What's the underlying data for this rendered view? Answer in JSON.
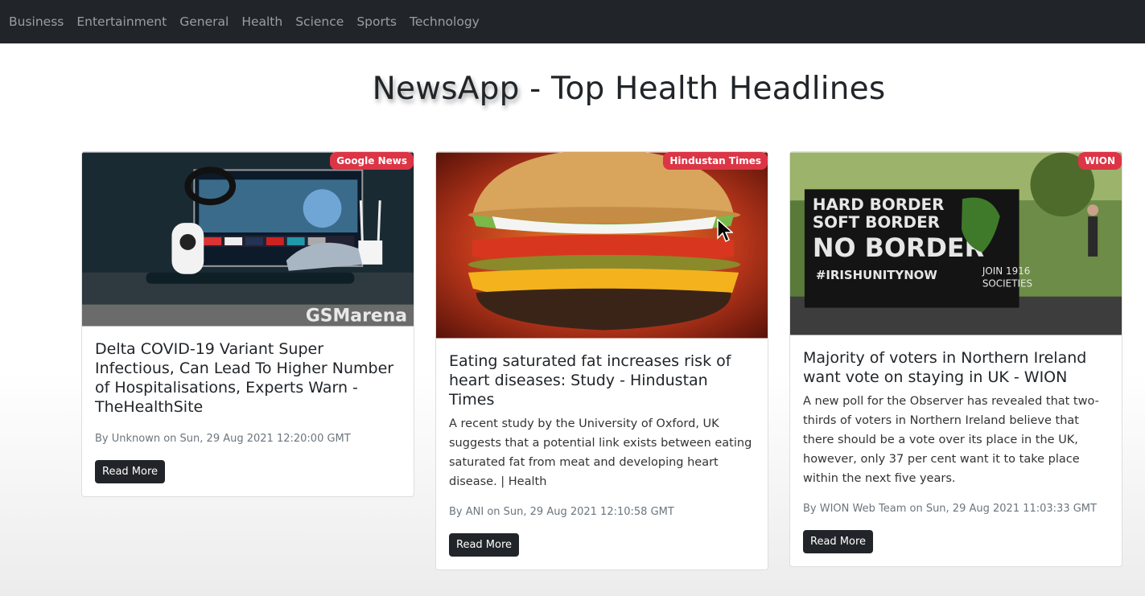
{
  "nav": {
    "items": [
      {
        "label": "Business"
      },
      {
        "label": "Entertainment"
      },
      {
        "label": "General"
      },
      {
        "label": "Health"
      },
      {
        "label": "Science"
      },
      {
        "label": "Sports"
      },
      {
        "label": "Technology"
      }
    ]
  },
  "page": {
    "title_brand": "NewsApp",
    "title_rest": " - Top Health Headlines"
  },
  "cards": [
    {
      "source": "Google News",
      "image_watermark": "GSMarena",
      "title": "Delta COVID-19 Variant Super Infectious, Can Lead To Higher Number of Hospitalisations, Experts Warn - TheHealthSite",
      "description": "",
      "meta": "By Unknown on Sun, 29 Aug 2021 12:20:00 GMT",
      "button": "Read More"
    },
    {
      "source": "Hindustan Times",
      "title": "Eating saturated fat increases risk of heart diseases: Study - Hindustan Times",
      "description": "A recent study by the University of Oxford, UK suggests that a potential link exists between eating saturated fat from meat and developing heart disease. | Health",
      "meta": "By ANI on Sun, 29 Aug 2021 12:10:58 GMT",
      "button": "Read More"
    },
    {
      "source": "WION",
      "image_sign": [
        "HARD BORDER",
        "SOFT BORDER",
        "NO BORDER",
        "#IRISHUNITYNOW",
        "JOIN 1916",
        "SOCIETIES"
      ],
      "title": "Majority of voters in Northern Ireland want vote on staying in UK - WION",
      "description": "A new poll for the Observer has revealed that two-thirds of voters in Northern Ireland believe that there should be a vote over its place in the UK, however, only 37 per cent want it to take place within the next five years.",
      "meta": "By WION Web Team on Sun, 29 Aug 2021 11:03:33 GMT",
      "button": "Read More"
    }
  ],
  "colors": {
    "navbar": "#212529",
    "badge": "#dc3545",
    "button": "#212529"
  }
}
